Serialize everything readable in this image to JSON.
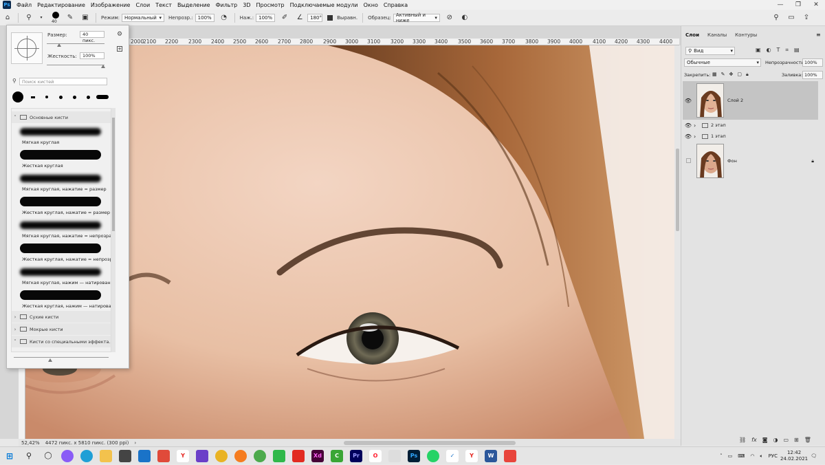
{
  "menubar": {
    "logo": "Ps",
    "items": [
      "Файл",
      "Редактирование",
      "Изображение",
      "Слои",
      "Текст",
      "Выделение",
      "Фильтр",
      "3D",
      "Просмотр",
      "Подключаемые модули",
      "Окно",
      "Справка"
    ],
    "controls": [
      "—",
      "❐",
      "✕"
    ]
  },
  "optbar": {
    "brush_size": "40",
    "mode_label": "Режим:",
    "mode_value": "Нормальный",
    "opacity_label": "Непрозр.:",
    "opacity_value": "100%",
    "pressure_label": "Наж.:",
    "pressure_value": "100%",
    "angle_value": "180°",
    "align_label": "Выравн.",
    "sample_label": "Образец:",
    "sample_value": "Активный и ниже"
  },
  "ruler_top": [
    "2000",
    "2100",
    "2200",
    "2300",
    "2400",
    "2500",
    "2600",
    "2700",
    "2800",
    "2900",
    "3000",
    "3100",
    "3200",
    "3300",
    "3400",
    "3500",
    "3600",
    "3700",
    "3800",
    "3900",
    "4000",
    "4100",
    "4200",
    "4300",
    "4400"
  ],
  "brush_panel": {
    "size_label": "Размер:",
    "size_value": "40 пикс.",
    "hardness_label": "Жесткость:",
    "hardness_value": "100%",
    "search_placeholder": "Поиск кистей",
    "groups": {
      "basic": "Основные кисти",
      "dry": "Сухие кисти",
      "wet": "Мокрые кисти",
      "special": "Кисти со специальными эффекта..."
    },
    "brushes": [
      "Мягкая круглая",
      "Жесткая круглая",
      "Мягкая круглая, нажатие = размер",
      "Жесткая круглая, нажатие = размер",
      "Мягкая круглая, нажатие = непрозрач.",
      "Жесткая круглая, нажатие = непрозра",
      "Мягкая круглая, нажим — натирование",
      "Жесткая круглая, нажим — натирование"
    ]
  },
  "right_panel": {
    "tabs": [
      "Слои",
      "Каналы",
      "Контуры"
    ],
    "filter_label": "Вид",
    "blend_mode": "Обычные",
    "opacity_label": "Непрозрачность:",
    "opacity_value": "100%",
    "lock_label": "Закрепить:",
    "fill_label": "Заливка:",
    "fill_value": "100%",
    "layers": [
      "Слой 2",
      "2 этап",
      "1 этап",
      "Фон"
    ]
  },
  "statusbar": {
    "zoom": "52,42%",
    "doc_info": "4472 пикс. x 5810 пикс. (300 ppi)"
  },
  "taskbar": {
    "lang": "РУС",
    "time": "12:42",
    "date": "24.02.2021"
  }
}
